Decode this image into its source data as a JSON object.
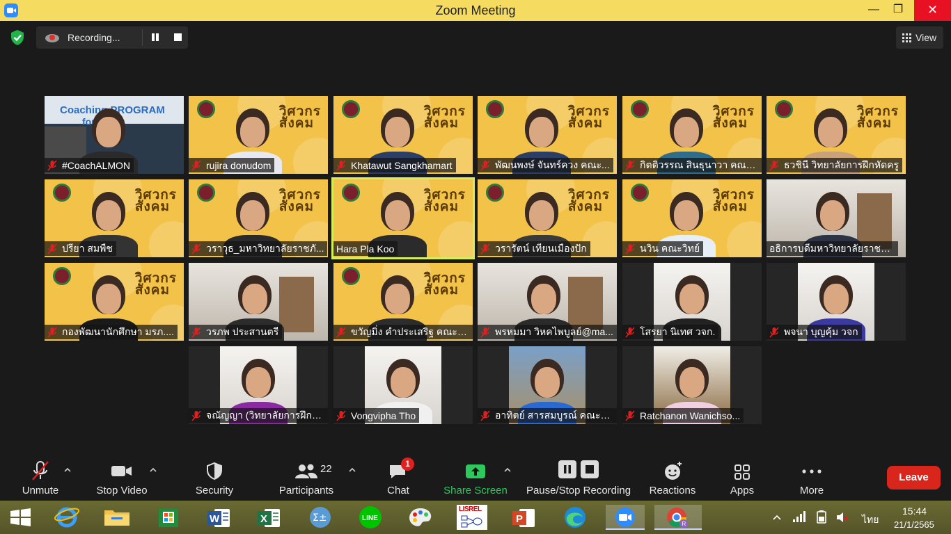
{
  "window": {
    "title": "Zoom Meeting",
    "minimize": "—",
    "maximize": "❐",
    "close": "✕"
  },
  "recording": {
    "label": "Recording..."
  },
  "view_button": {
    "label": "View"
  },
  "brand_text": "วิศวกร\nสังคม",
  "participants": [
    {
      "name": "#CoachALMON",
      "muted": true
    },
    {
      "name": "rujira donudom",
      "muted": true
    },
    {
      "name": "Khatawut Sangkhamart",
      "muted": true
    },
    {
      "name": "พัฒนพงษ์ จันทร์ควง คณะ...",
      "muted": true
    },
    {
      "name": "กิตติวรรณ สินธุนาวา คณะ...",
      "muted": true
    },
    {
      "name": "ธวชินี  วิทยาลัยการฝึกหัดครู",
      "muted": true
    },
    {
      "name": "ปรียา สมพืช",
      "muted": true
    },
    {
      "name": "วราวุธ_มหาวิทยาลัยราชภั...",
      "muted": true
    },
    {
      "name": "Hara Pla Koo",
      "muted": false
    },
    {
      "name": "วรารัตน์ เทียนเมืองปัก",
      "muted": true
    },
    {
      "name": "นวิน คณะวิทย์",
      "muted": true
    },
    {
      "name": "อธิการบดีมหาวิทยาลัยราชภัฏ...",
      "muted": false
    },
    {
      "name": "กองพัฒนานักศึกษา มรภ....",
      "muted": true
    },
    {
      "name": "วรภพ ประสานตรี",
      "muted": true
    },
    {
      "name": "ขวัญมิ่ง คำประเสริฐ คณะวิ...",
      "muted": true
    },
    {
      "name": "พรหมมา วิหคไพบูลย์@ma...",
      "muted": true
    },
    {
      "name": "โสรยา นิเทศ วจก.",
      "muted": true
    },
    {
      "name": "พจนา บุญคุ้ม วจก",
      "muted": true
    },
    {
      "name": "จณัญญา (วิทยาลัยการฝึกหั...",
      "muted": true
    },
    {
      "name": "Vongvipha Tho",
      "muted": true
    },
    {
      "name": "อาทิตย์ สารสมบูรณ์ คณะวิ...",
      "muted": true
    },
    {
      "name": "Ratchanon Wanichso...",
      "muted": true
    }
  ],
  "coach_banner": {
    "line1": "Coaching PROGRAM",
    "line2": "for l    rer"
  },
  "toolbar": {
    "unmute": "Unmute",
    "stop_video": "Stop Video",
    "security": "Security",
    "participants": "Participants",
    "participants_count": "22",
    "chat": "Chat",
    "chat_badge": "1",
    "share_screen": "Share Screen",
    "pause_stop_recording": "Pause/Stop Recording",
    "reactions": "Reactions",
    "apps": "Apps",
    "more": "More",
    "leave": "Leave"
  },
  "taskbar": {
    "lang": "ไทย",
    "time": "15:44",
    "date": "21/1/2565",
    "lisrel": "LISREL"
  },
  "colors": {
    "accent_green": "#2dc95c",
    "leave_red": "#d9261c",
    "tile_yellow": "#f2c249",
    "titlebar": "#f5dc60"
  }
}
